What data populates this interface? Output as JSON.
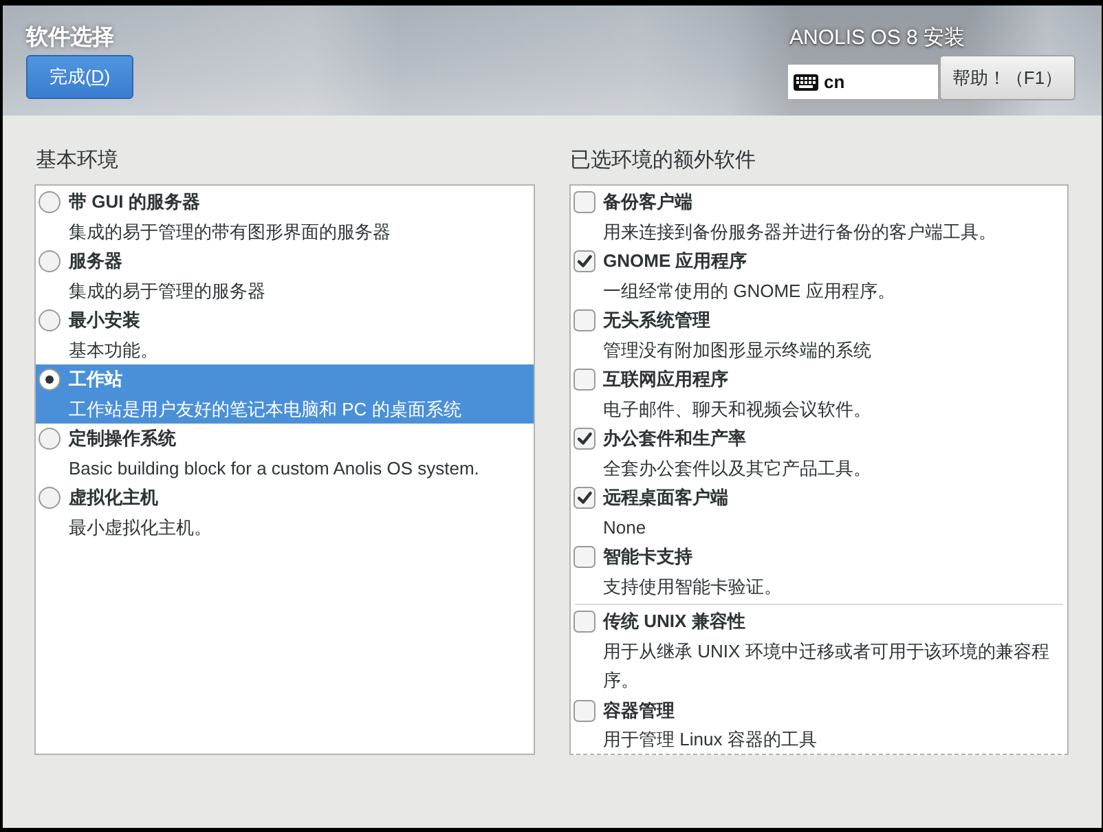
{
  "header": {
    "title": "软件选择",
    "done_button": {
      "text_before": "完成(",
      "mnemonic": "D",
      "text_after": ")"
    },
    "product": "ANOLIS OS 8 安装",
    "keyboard_layout": "cn",
    "help_button": "帮助！（F1）"
  },
  "base_environment": {
    "heading": "基本环境",
    "items": [
      {
        "title": "带 GUI 的服务器",
        "description": "集成的易于管理的带有图形界面的服务器",
        "selected": false
      },
      {
        "title": "服务器",
        "description": "集成的易于管理的服务器",
        "selected": false
      },
      {
        "title": "最小安装",
        "description": "基本功能。",
        "selected": false
      },
      {
        "title": "工作站",
        "description": "工作站是用户友好的笔记本电脑和 PC 的桌面系统",
        "selected": true
      },
      {
        "title": "定制操作系统",
        "description": "Basic building block for a custom Anolis OS system.",
        "selected": false
      },
      {
        "title": "虚拟化主机",
        "description": "最小虚拟化主机。",
        "selected": false
      }
    ]
  },
  "add_ons": {
    "heading": "已选环境的额外软件",
    "groups": [
      {
        "items": [
          {
            "title": "备份客户端",
            "description": "用来连接到备份服务器并进行备份的客户端工具。",
            "checked": false
          },
          {
            "title": "GNOME 应用程序",
            "description": "一组经常使用的 GNOME 应用程序。",
            "checked": true
          },
          {
            "title": "无头系统管理",
            "description": "管理没有附加图形显示终端的系统",
            "checked": false
          },
          {
            "title": "互联网应用程序",
            "description": "电子邮件、聊天和视频会议软件。",
            "checked": false
          },
          {
            "title": "办公套件和生产率",
            "description": "全套办公套件以及其它产品工具。",
            "checked": true
          },
          {
            "title": "远程桌面客户端",
            "description": "None",
            "checked": true
          },
          {
            "title": "智能卡支持",
            "description": "支持使用智能卡验证。",
            "checked": false
          }
        ]
      },
      {
        "items": [
          {
            "title": "传统 UNIX 兼容性",
            "description": "用于从继承 UNIX 环境中迁移或者可用于该环境的兼容程序。",
            "checked": false
          },
          {
            "title": "容器管理",
            "description": "用于管理 Linux 容器的工具",
            "checked": false
          }
        ]
      }
    ]
  }
}
